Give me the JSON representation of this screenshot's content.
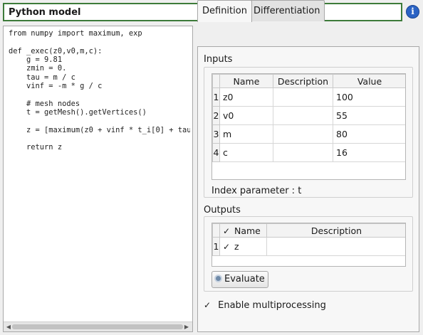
{
  "model": {
    "title": "Python model",
    "info_icon": "i"
  },
  "code": {
    "lines": [
      "from numpy import maximum, exp",
      "",
      "def _exec(z0,v0,m,c):",
      "    g = 9.81",
      "    zmin = 0.",
      "    tau = m / c",
      "    vinf = -m * g / c",
      "",
      "    # mesh nodes",
      "    t = getMesh().getVertices()",
      "",
      "    z = [maximum(z0 + vinf * t_i[0] + tau",
      "",
      "    return z"
    ]
  },
  "tabs": [
    {
      "label": "Definition"
    },
    {
      "label": "Differentiation"
    }
  ],
  "inputs": {
    "title": "Inputs",
    "columns": [
      "Name",
      "Description",
      "Value"
    ],
    "rows": [
      {
        "num": "1",
        "name": "z0",
        "description": "",
        "value": "100"
      },
      {
        "num": "2",
        "name": "v0",
        "description": "",
        "value": "55"
      },
      {
        "num": "3",
        "name": "m",
        "description": "",
        "value": "80"
      },
      {
        "num": "4",
        "name": "c",
        "description": "",
        "value": "16"
      }
    ],
    "index_parameter": "Index parameter : t"
  },
  "outputs": {
    "title": "Outputs",
    "header_check": "✓",
    "columns": [
      "Name",
      "Description"
    ],
    "rows": [
      {
        "num": "1",
        "check": "✓",
        "name": "z",
        "description": ""
      }
    ]
  },
  "evaluate_label": "Evaluate",
  "multiprocessing": {
    "check": "✓",
    "label": "Enable multiprocessing"
  },
  "scroll_left": "◀",
  "scroll_right": "▶"
}
